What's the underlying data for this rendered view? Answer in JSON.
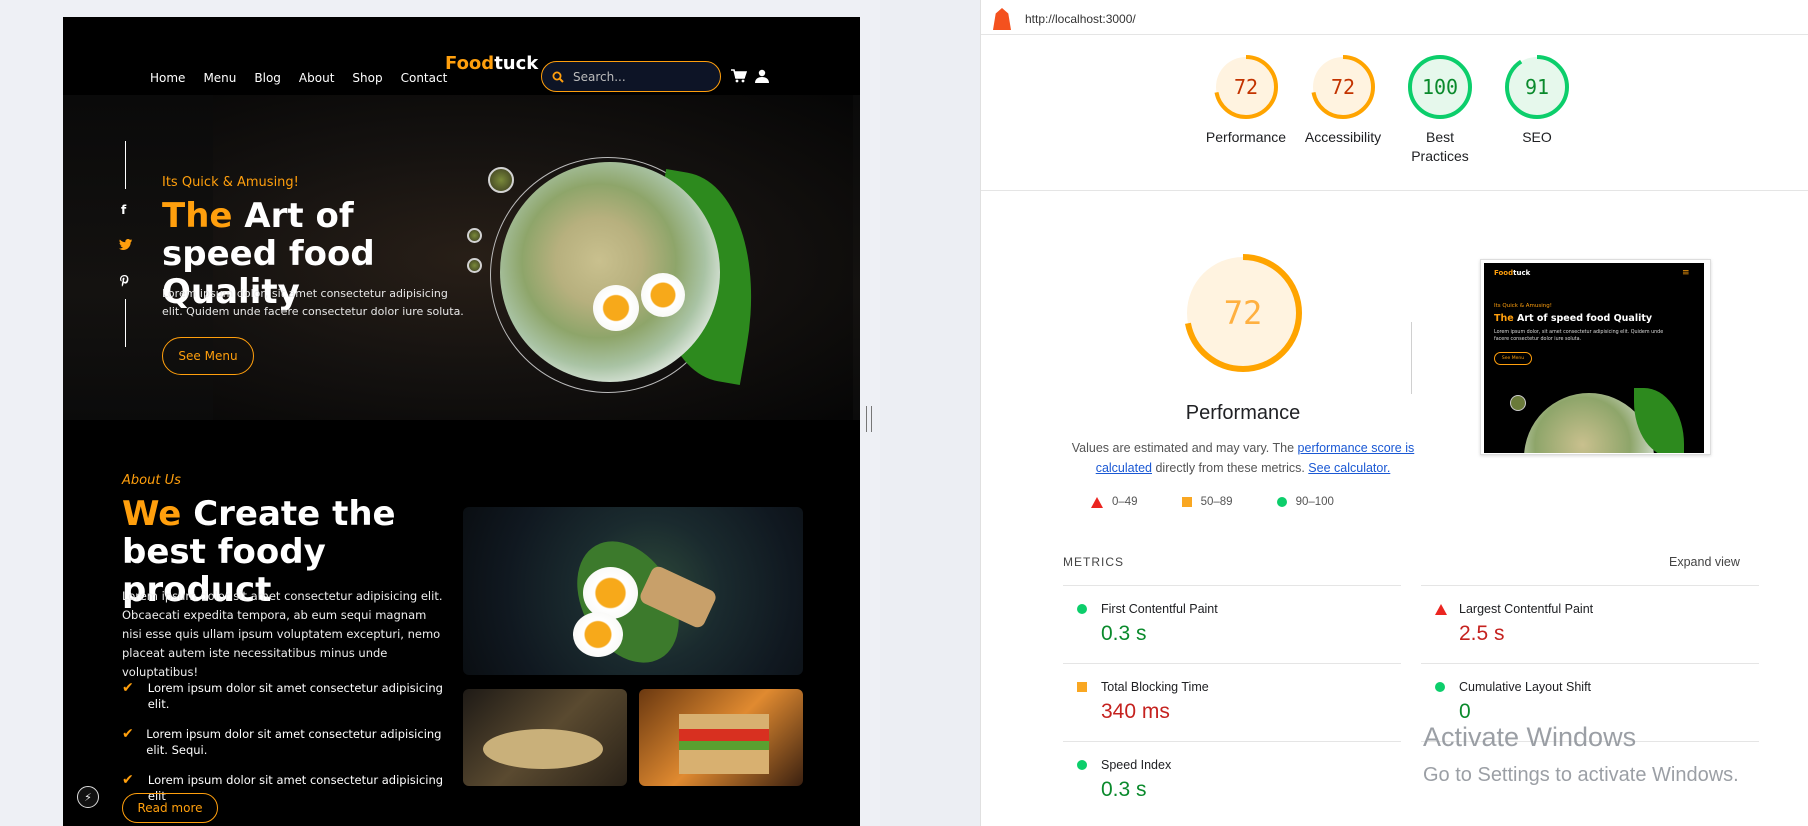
{
  "site": {
    "nav": [
      "Home",
      "Menu",
      "Blog",
      "About",
      "Shop",
      "Contact"
    ],
    "logo_a": "Food",
    "logo_b": "tuck",
    "search_placeholder": "Search...",
    "hero": {
      "tagline": "Its Quick & Amusing!",
      "title_accent": "The",
      "title_rest": " Art of speed food Quality",
      "text": "Lorem ipsum dolor, sit amet consectetur adipisicing elit. Quidem unde facere consectetur dolor iure soluta.",
      "button": "See Menu"
    },
    "about": {
      "tag": "About Us",
      "title_accent": "We",
      "title_rest": " Create the best foody product",
      "text": "Lorem ipsum dolor sit amet consectetur adipisicing elit. Obcaecati expedita tempora, ab eum sequi magnam nisi esse quis ullam ipsum voluptatem excepturi, nemo placeat autem iste necessitatibus minus unde voluptatibus!",
      "checks": [
        "Lorem ipsum dolor sit amet consectetur adipisicing elit.",
        "Lorem ipsum dolor sit amet consectetur adipisicing elit. Sequi.",
        "Lorem ipsum dolor sit amet consectetur adipisicing elit"
      ],
      "button": "Read more"
    }
  },
  "lighthouse": {
    "url": "http://localhost:3000/",
    "scores": [
      {
        "label": "Performance",
        "value": "72",
        "status": "average"
      },
      {
        "label": "Accessibility",
        "value": "72",
        "status": "average"
      },
      {
        "label": "Best Practices",
        "value": "100",
        "status": "pass"
      },
      {
        "label": "SEO",
        "value": "91",
        "status": "pass"
      }
    ],
    "main_score": "72",
    "main_label": "Performance",
    "note_pre": "Values are estimated and may vary. The ",
    "note_link1": "performance score is calculated",
    "note_mid": " directly from these metrics. ",
    "note_link2": "See calculator.",
    "legend": [
      "0–49",
      "50–89",
      "90–100"
    ],
    "metrics_title": "METRICS",
    "expand": "Expand view",
    "metrics": [
      {
        "label": "First Contentful Paint",
        "value": "0.3 s",
        "status": "pass"
      },
      {
        "label": "Largest Contentful Paint",
        "value": "2.5 s",
        "status": "fail"
      },
      {
        "label": "Total Blocking Time",
        "value": "340 ms",
        "status": "average"
      },
      {
        "label": "Cumulative Layout Shift",
        "value": "0",
        "status": "pass"
      },
      {
        "label": "Speed Index",
        "value": "0.3 s",
        "status": "pass"
      }
    ],
    "thumb": {
      "logo_a": "Food",
      "logo_b": "tuck",
      "tagline": "Its Quick & Amusing!",
      "title_accent": "The",
      "title_rest": " Art of speed food Quality",
      "text": "Lorem ipsum dolor, sit amet consectetur adipisicing elit. Quidem unde facere consectetur dolor iure soluta.",
      "button": "See Menu"
    }
  },
  "watermark": {
    "line1": "Activate Windows",
    "line2": "Go to Settings to activate Windows."
  },
  "colors": {
    "accent": "#ff9f0d",
    "pass": "#0cce6b",
    "average": "#ffa400",
    "fail": "#ff4e42"
  }
}
